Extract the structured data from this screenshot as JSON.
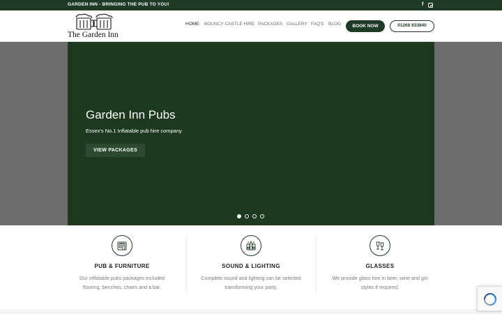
{
  "topbar": {
    "tagline": "GARDEN INN - BRINGING THE PUB TO YOU!",
    "social_icons": [
      "facebook-icon",
      "instagram-icon"
    ]
  },
  "header": {
    "logo_name": "The Garden Inn",
    "nav": [
      {
        "label": "HOME",
        "active": true
      },
      {
        "label": "BOUNCY CASTLE HIRE",
        "active": false
      },
      {
        "label": "PACKAGES",
        "active": false
      },
      {
        "label": "GALLERY",
        "active": false
      },
      {
        "label": "FAQ'S",
        "active": false
      },
      {
        "label": "BLOG",
        "active": false
      }
    ],
    "book_label": "BOOK NOW",
    "phone_label": "01268 833840"
  },
  "hero": {
    "title": "Garden Inn Pubs",
    "subtitle": "Essex's No.1 Inflatable pub hire company",
    "button_label": "VIEW PACKAGES",
    "slide_count": 4,
    "active_slide": 1
  },
  "features": [
    {
      "icon": "pub-building-icon",
      "title": "PUB & FURNITURE",
      "desc_line1": "Our inflatable pubs packages included",
      "desc_line2": "flooring, benches, chairs and a bar."
    },
    {
      "icon": "speaker-lights-icon",
      "title": "SOUND & LIGHTING",
      "desc_line1": "Complete sound and lighting can be selected",
      "desc_line2": "transforming your party."
    },
    {
      "icon": "glasses-icon",
      "title": "GLASSES",
      "desc_line1": "We provide glass hire in beer, wine and gin",
      "desc_line2": "styles if required."
    }
  ],
  "colors": {
    "brand_green": "#1e3a24",
    "hero_green": "#1d3a20",
    "hero_side_grey": "#6d6d6d"
  }
}
